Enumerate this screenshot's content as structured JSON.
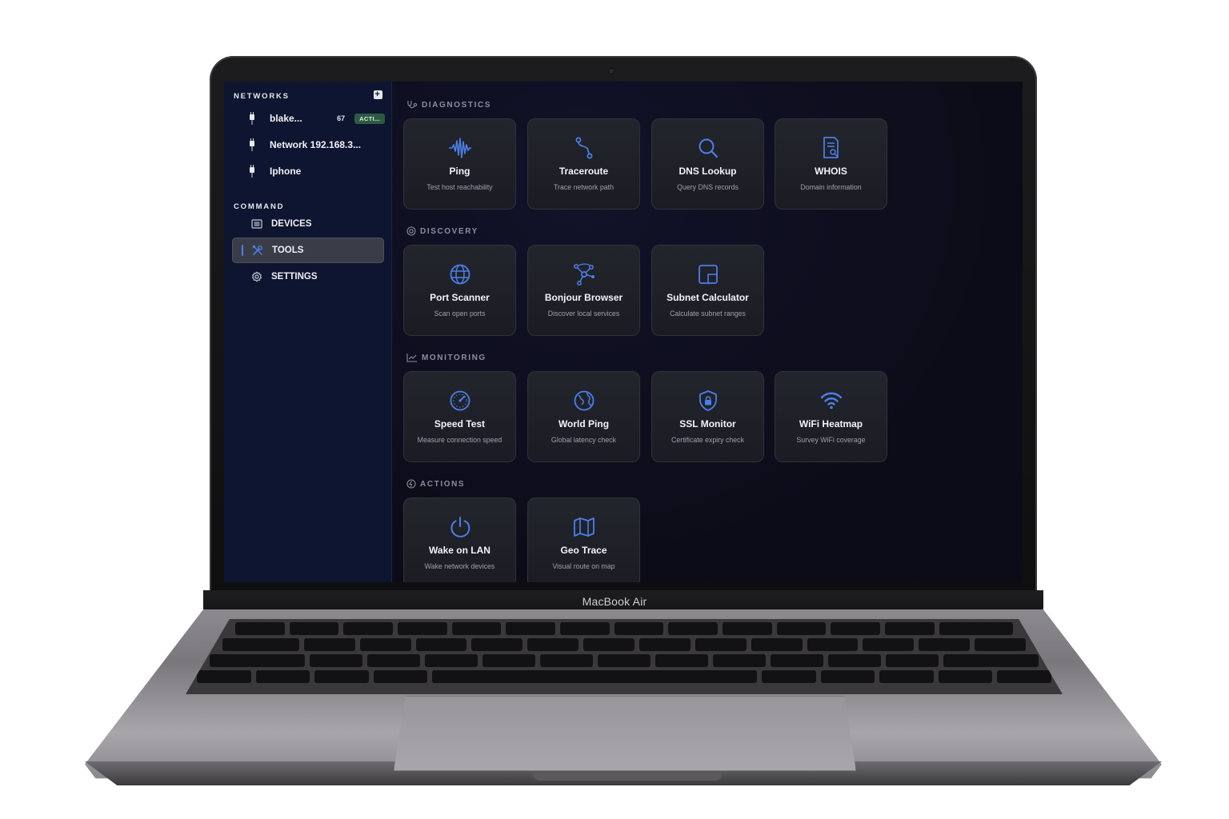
{
  "device": {
    "brand_label": "MacBook Air"
  },
  "colors": {
    "accent": "#4b7fe8",
    "badge_bg": "#2d5a43",
    "sidebar_bg": "#0e1530",
    "card_bg": "#23252d"
  },
  "sidebar": {
    "networks_header": "NETWORKS",
    "add_icon": "plus-icon",
    "networks": [
      {
        "label": "blake...",
        "count": "67",
        "badge": "ACTI...",
        "icon": "ethernet-plug-icon"
      },
      {
        "label": "Network 192.168.3...",
        "icon": "ethernet-plug-icon"
      },
      {
        "label": "Iphone",
        "icon": "ethernet-plug-icon"
      }
    ],
    "command_header": "COMMAND",
    "nav": [
      {
        "label": "DEVICES",
        "icon": "list-icon",
        "active": false
      },
      {
        "label": "TOOLS",
        "icon": "tools-icon",
        "active": true
      },
      {
        "label": "SETTINGS",
        "icon": "gear-icon",
        "active": false
      }
    ]
  },
  "sections": {
    "diagnostics": {
      "title": "DIAGNOSTICS",
      "icon": "stethoscope-icon",
      "cards": [
        {
          "title": "Ping",
          "desc": "Test host reachability",
          "icon": "waveform-icon"
        },
        {
          "title": "Traceroute",
          "desc": "Trace network path",
          "icon": "route-icon"
        },
        {
          "title": "DNS Lookup",
          "desc": "Query DNS records",
          "icon": "search-icon"
        },
        {
          "title": "WHOIS",
          "desc": "Domain information",
          "icon": "document-search-icon"
        }
      ]
    },
    "discovery": {
      "title": "DISCOVERY",
      "icon": "radar-icon",
      "cards": [
        {
          "title": "Port Scanner",
          "desc": "Scan open ports",
          "icon": "globe-icon"
        },
        {
          "title": "Bonjour Browser",
          "desc": "Discover local services",
          "icon": "network-nodes-icon"
        },
        {
          "title": "Subnet Calculator",
          "desc": "Calculate subnet ranges",
          "icon": "grid-square-icon"
        }
      ]
    },
    "monitoring": {
      "title": "MONITORING",
      "icon": "chart-line-icon",
      "cards": [
        {
          "title": "Speed Test",
          "desc": "Measure connection speed",
          "icon": "gauge-icon"
        },
        {
          "title": "World Ping",
          "desc": "Global latency check",
          "icon": "globe-icon"
        },
        {
          "title": "SSL Monitor",
          "desc": "Certificate expiry check",
          "icon": "shield-lock-icon"
        },
        {
          "title": "WiFi Heatmap",
          "desc": "Survey WiFi coverage",
          "icon": "wifi-icon"
        }
      ]
    },
    "actions": {
      "title": "ACTIONS",
      "icon": "bolt-circle-icon",
      "cards": [
        {
          "title": "Wake on LAN",
          "desc": "Wake network devices",
          "icon": "power-icon"
        },
        {
          "title": "Geo Trace",
          "desc": "Visual route on map",
          "icon": "map-icon"
        }
      ]
    }
  }
}
